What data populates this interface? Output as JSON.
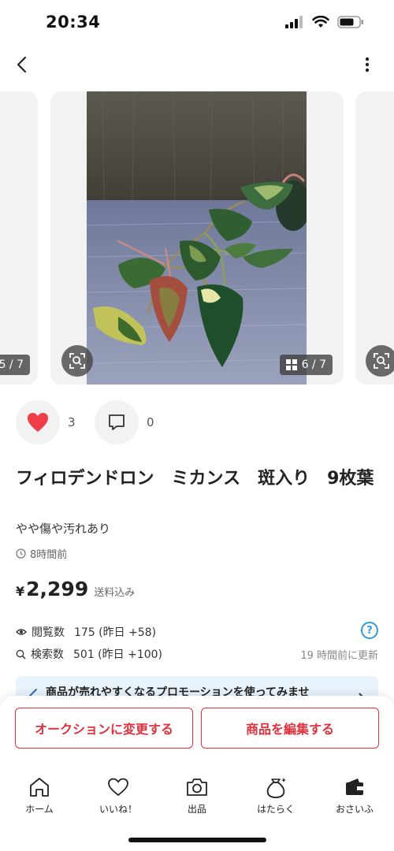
{
  "status_bar": {
    "time": "20:34"
  },
  "carousel": {
    "prev_counter": "5 / 7",
    "current_counter": "6 / 7"
  },
  "actions": {
    "like_count": "3",
    "comment_count": "0"
  },
  "item": {
    "title": "フィロデンドロン　ミカンス　斑入り　9枚葉",
    "condition": "やや傷や汚れあり",
    "posted": "8時間前",
    "price_symbol": "¥",
    "price": "2,299",
    "shipping_note": "送料込み"
  },
  "stats": {
    "views_label": "閲覧数",
    "views_value": "175 (昨日 +58)",
    "searches_label": "検索数",
    "searches_value": "501 (昨日 +100)",
    "updated": "19 時間前に更新"
  },
  "promo": {
    "text": "商品が売れやすくなるプロモーションを使ってみませ"
  },
  "buttons": {
    "auction": "オークションに変更する",
    "edit": "商品を編集する"
  },
  "tabbar": {
    "items": [
      {
        "label": "ホーム",
        "icon": "home-icon"
      },
      {
        "label": "いいね！",
        "icon": "heart-icon"
      },
      {
        "label": "出品",
        "icon": "camera-icon"
      },
      {
        "label": "はたらく",
        "icon": "money-bag-icon"
      },
      {
        "label": "おさいふ",
        "icon": "wallet-icon"
      }
    ]
  },
  "colors": {
    "accent_red": "#e2303d",
    "heart_red": "#ef3e4a",
    "info_blue": "#2f9bd8",
    "promo_bg": "#e9f3fb"
  }
}
